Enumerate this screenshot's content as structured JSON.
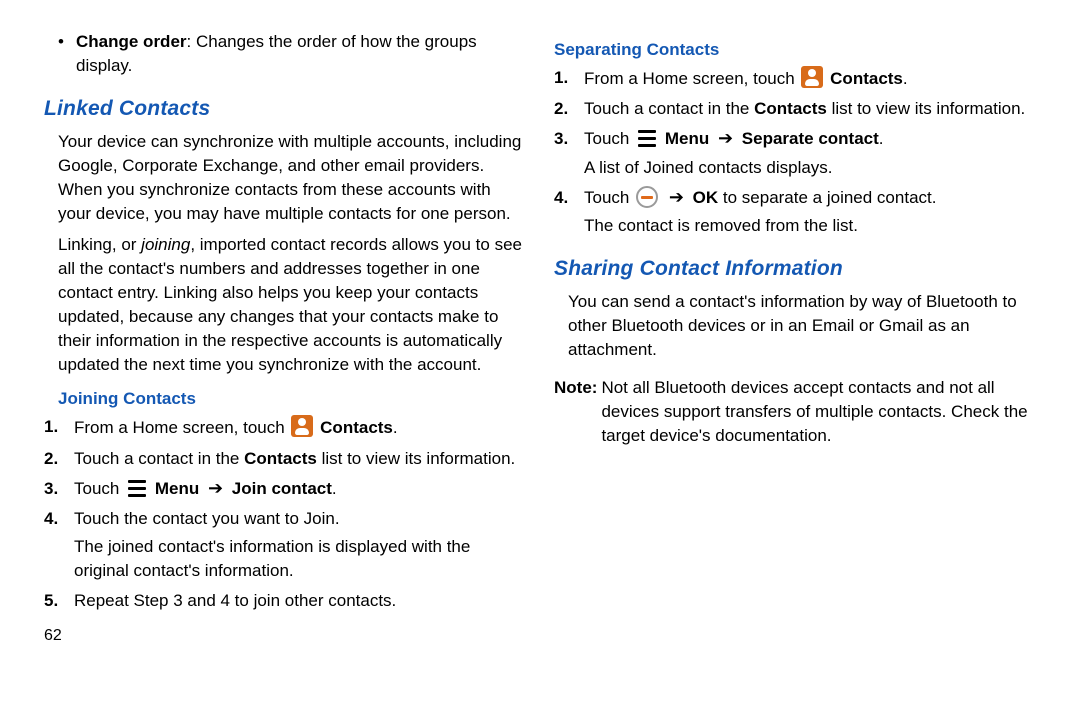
{
  "pageNumber": "62",
  "left": {
    "bullet": {
      "label": "Change order",
      "rest": ": Changes the order of how the groups display."
    },
    "linked": {
      "heading": "Linked Contacts",
      "p1": "Your device can synchronize with multiple accounts, including Google, Corporate Exchange, and other email providers. When you synchronize contacts from these accounts with your device, you may have multiple contacts for one person.",
      "p2a": "Linking, or ",
      "p2em": "joining",
      "p2b": ", imported contact records allows you to see all the contact's numbers and addresses together in one contact entry. Linking also helps you keep your contacts updated, because any changes that your contacts make to their information in the respective accounts is automatically updated the next time you synchronize with the account."
    },
    "joining": {
      "heading": "Joining Contacts",
      "s1a": "From a Home screen, touch ",
      "s1b": "Contacts",
      "s1c": ".",
      "s2a": "Touch a contact in the ",
      "s2b": "Contacts",
      "s2c": " list to view its information.",
      "s3a": "Touch ",
      "s3b": "Menu",
      "s3c": "Join contact",
      "s3d": ".",
      "s4": "Touch the contact you want to Join.",
      "s4sub": "The joined contact's information is displayed with the original contact's information.",
      "s5": "Repeat Step 3 and 4 to join other contacts."
    }
  },
  "right": {
    "separating": {
      "heading": "Separating Contacts",
      "s1a": "From a Home screen, touch ",
      "s1b": "Contacts",
      "s1c": ".",
      "s2a": "Touch a contact in the ",
      "s2b": "Contacts",
      "s2c": " list to view its information.",
      "s3a": "Touch ",
      "s3b": "Menu",
      "s3c": "Separate contact",
      "s3d": ".",
      "s3sub": "A list of Joined contacts displays.",
      "s4a": "Touch ",
      "s4b": "OK",
      "s4c": " to separate a joined contact.",
      "s4sub": "The contact is removed from the list."
    },
    "sharing": {
      "heading": "Sharing Contact Information",
      "p1": "You can send a contact's information by way of Bluetooth to other Bluetooth devices or in an Email or Gmail as an attachment.",
      "noteLabel": "Note:",
      "noteBody": "Not all Bluetooth devices accept contacts and not all devices support transfers of multiple contacts. Check the target device's documentation."
    }
  }
}
